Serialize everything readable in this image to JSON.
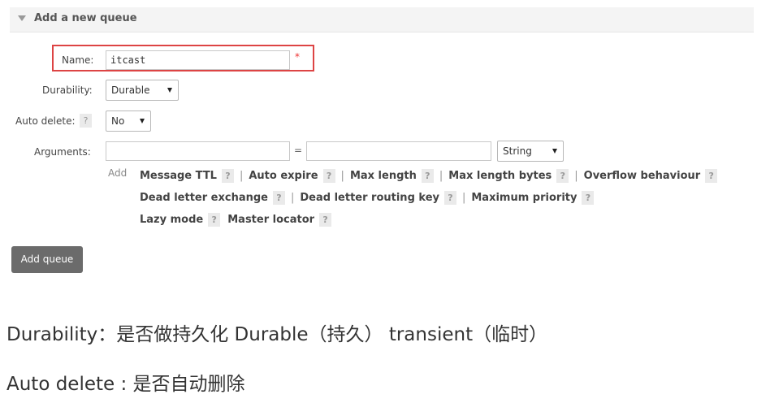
{
  "header": {
    "title": "Add a new queue"
  },
  "form": {
    "name_label": "Name:",
    "name_value": "itcast",
    "required_mark": "*",
    "durability_label": "Durability:",
    "durability_value": "Durable",
    "auto_delete_label": "Auto delete:",
    "auto_delete_value": "No",
    "help_mark": "?",
    "arguments_label": "Arguments:",
    "arguments_key": "",
    "equals": "=",
    "arguments_value": "",
    "arguments_type": "String",
    "add_label": "Add"
  },
  "argument_options": {
    "message_ttl": "Message TTL",
    "auto_expire": "Auto expire",
    "max_length": "Max length",
    "max_length_bytes": "Max length bytes",
    "overflow_behaviour": "Overflow behaviour",
    "dead_letter_exchange": "Dead letter exchange",
    "dead_letter_routing_key": "Dead letter routing key",
    "maximum_priority": "Maximum priority",
    "lazy_mode": "Lazy mode",
    "master_locator": "Master locator",
    "separator": "|"
  },
  "add_queue_button": "Add queue",
  "notes": {
    "durability_line": "Durability：是否做持久化   Durable（持久）      transient（临时）",
    "auto_delete_line": "Auto delete : 是否自动删除"
  },
  "colors": {
    "highlight_border": "#dd4444",
    "button_bg": "#6b6b6b",
    "header_bg": "#f4f4f4"
  },
  "icons": [
    "collapse-triangle-icon",
    "help-icon",
    "dropdown-arrow-icon"
  ]
}
